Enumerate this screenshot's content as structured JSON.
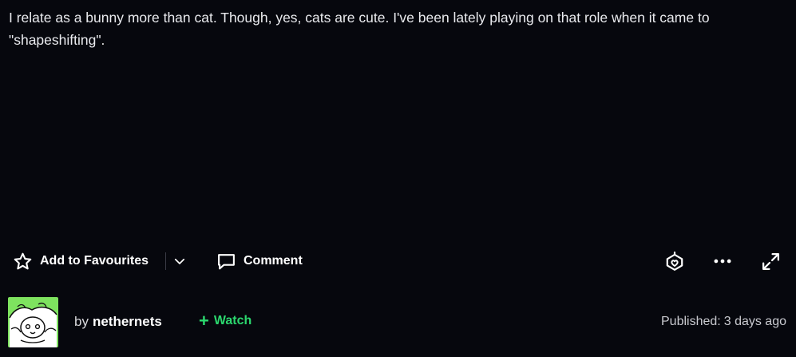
{
  "description": {
    "text": "I relate as a bunny more than cat. Though, yes, cats are cute. I've been lately playing on that role when it came to \"shapeshifting\"."
  },
  "toolbar": {
    "favourite_label": "Add to Favourites",
    "comment_label": "Comment",
    "icons": {
      "favourite": "star-outline-icon",
      "favourite_dropdown": "chevron-down-icon",
      "comment": "speech-bubble-icon",
      "share": "share-badge-icon",
      "more": "more-dots-icon",
      "expand": "expand-arrows-icon"
    }
  },
  "footer": {
    "by_label": "by",
    "author": "nethernets",
    "watch_label": "Watch",
    "published_label": "Published:",
    "published_value": "3 days ago"
  },
  "colors": {
    "background": "#06070d",
    "text": "#e9eaee",
    "watch_accent": "#2bd86e",
    "avatar_bg": "#7ee35f"
  }
}
